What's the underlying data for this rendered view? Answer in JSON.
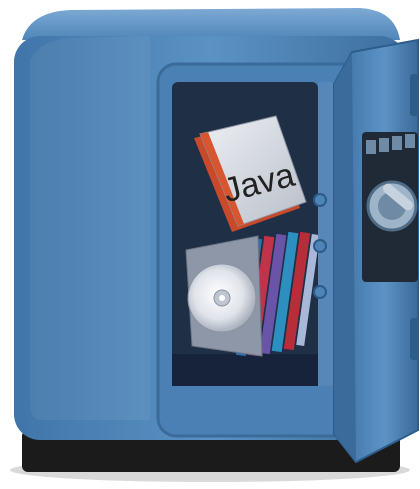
{
  "illustration": {
    "book": {
      "title": "Java"
    },
    "colors": {
      "safe_body": "#4a7fb0",
      "safe_dark": "#2f5f8c",
      "interior": "#1f2f45",
      "book_cover": "#d9dde4",
      "book_spine": "#d6562f",
      "cd_disc": "#e6e8ec"
    },
    "icons": [
      "safe-icon",
      "dial-icon",
      "hinge-icon",
      "cd-icon",
      "book-icon"
    ]
  }
}
